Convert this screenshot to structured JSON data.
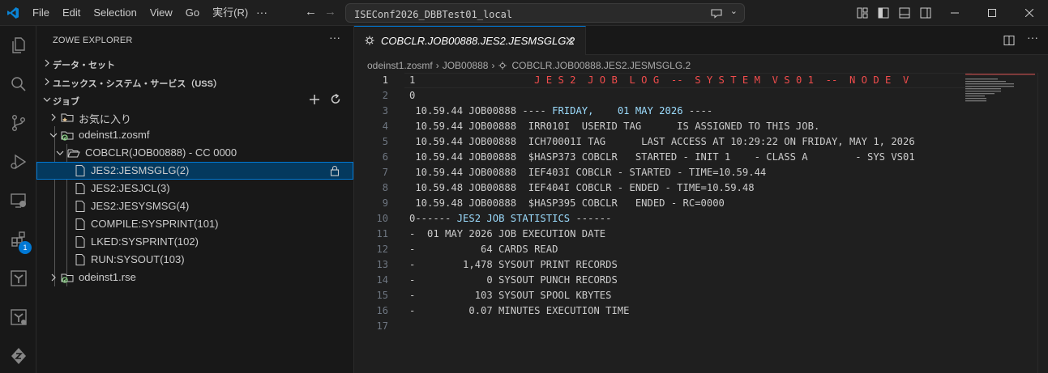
{
  "titlebar": {
    "menu": [
      "File",
      "Edit",
      "Selection",
      "View",
      "Go",
      "実行(R)"
    ],
    "more": "···",
    "search_text": "ISEConf2026_DBBTest01_local"
  },
  "activity_bar": {
    "extensions_badge": "1"
  },
  "sidebar": {
    "title": "ZOWE EXPLORER",
    "more": "···",
    "sections": {
      "datasets": "データ・セット",
      "uss": "ユニックス・システム・サービス（USS）",
      "jobs": "ジョブ"
    },
    "tree": {
      "favorites": "お気に入り",
      "profile1": "odeinst1.zosmf",
      "job": "COBCLR(JOB00888) - CC 0000",
      "spool_files": [
        "JES2:JESMSGLG(2)",
        "JES2:JESJCL(3)",
        "JES2:JESYSMSG(4)",
        "COMPILE:SYSPRINT(101)",
        "LKED:SYSPRINT(102)",
        "RUN:SYSOUT(103)"
      ],
      "profile2": "odeinst1.rse"
    }
  },
  "editor": {
    "tab_label": "COBCLR.JOB00888.JES2.JESMSGLG.2",
    "breadcrumbs": [
      "odeinst1.zosmf",
      "JOB00888",
      "COBCLR.JOB00888.JES2.JESMSGLG.2"
    ],
    "line_numbers": [
      "1",
      "2",
      "3",
      "4",
      "5",
      "6",
      "7",
      "8",
      "9",
      "10",
      "11",
      "12",
      "13",
      "14",
      "15",
      "16",
      "17"
    ],
    "lines": [
      {
        "a": "1",
        "b": "                    J E S 2  J O B  L O G  --  S Y S T E M  V S 0 1  --  N O D E  V",
        "c": ""
      },
      {
        "a": "0",
        "b": "",
        "c": ""
      },
      {
        "a": " 10.59.44 JOB00888 ---- ",
        "b": "FRIDAY,    01 MAY 2026",
        "c": " ----"
      },
      {
        "a": " 10.59.44 JOB00888  IRR010I  USERID TAG      IS ASSIGNED TO THIS JOB.",
        "b": "",
        "c": ""
      },
      {
        "a": " 10.59.44 JOB00888  ICH70001I TAG      LAST ACCESS AT 10:29:22 ON FRIDAY, MAY 1, 2026",
        "b": "",
        "c": ""
      },
      {
        "a": " 10.59.44 JOB00888  $HASP373 COBCLR   STARTED - INIT 1    - CLASS A        - SYS VS01",
        "b": "",
        "c": ""
      },
      {
        "a": " 10.59.44 JOB00888  IEF403I COBCLR - STARTED - TIME=10.59.44",
        "b": "",
        "c": ""
      },
      {
        "a": " 10.59.48 JOB00888  IEF404I COBCLR - ENDED - TIME=10.59.48",
        "b": "",
        "c": ""
      },
      {
        "a": " 10.59.48 JOB00888  $HASP395 COBCLR   ENDED - RC=0000",
        "b": "",
        "c": ""
      },
      {
        "a": "0------ ",
        "b": "JES2 JOB STATISTICS",
        "c": " ------"
      },
      {
        "a": "-  01 MAY 2026 JOB EXECUTION DATE",
        "b": "",
        "c": ""
      },
      {
        "a": "-           64 CARDS READ",
        "b": "",
        "c": ""
      },
      {
        "a": "-        1,478 SYSOUT PRINT RECORDS",
        "b": "",
        "c": ""
      },
      {
        "a": "-            0 SYSOUT PUNCH RECORDS",
        "b": "",
        "c": ""
      },
      {
        "a": "-          103 SYSOUT SPOOL KBYTES",
        "b": "",
        "c": ""
      },
      {
        "a": "-         0.07 MINUTES EXECUTION TIME",
        "b": "",
        "c": ""
      },
      {
        "a": "",
        "b": "",
        "c": ""
      }
    ]
  },
  "colors": {
    "accent": "#0078d4",
    "selection": "#04395e",
    "log_header_red": "#f14c4c",
    "keyword_blue": "#9cdcfe"
  }
}
